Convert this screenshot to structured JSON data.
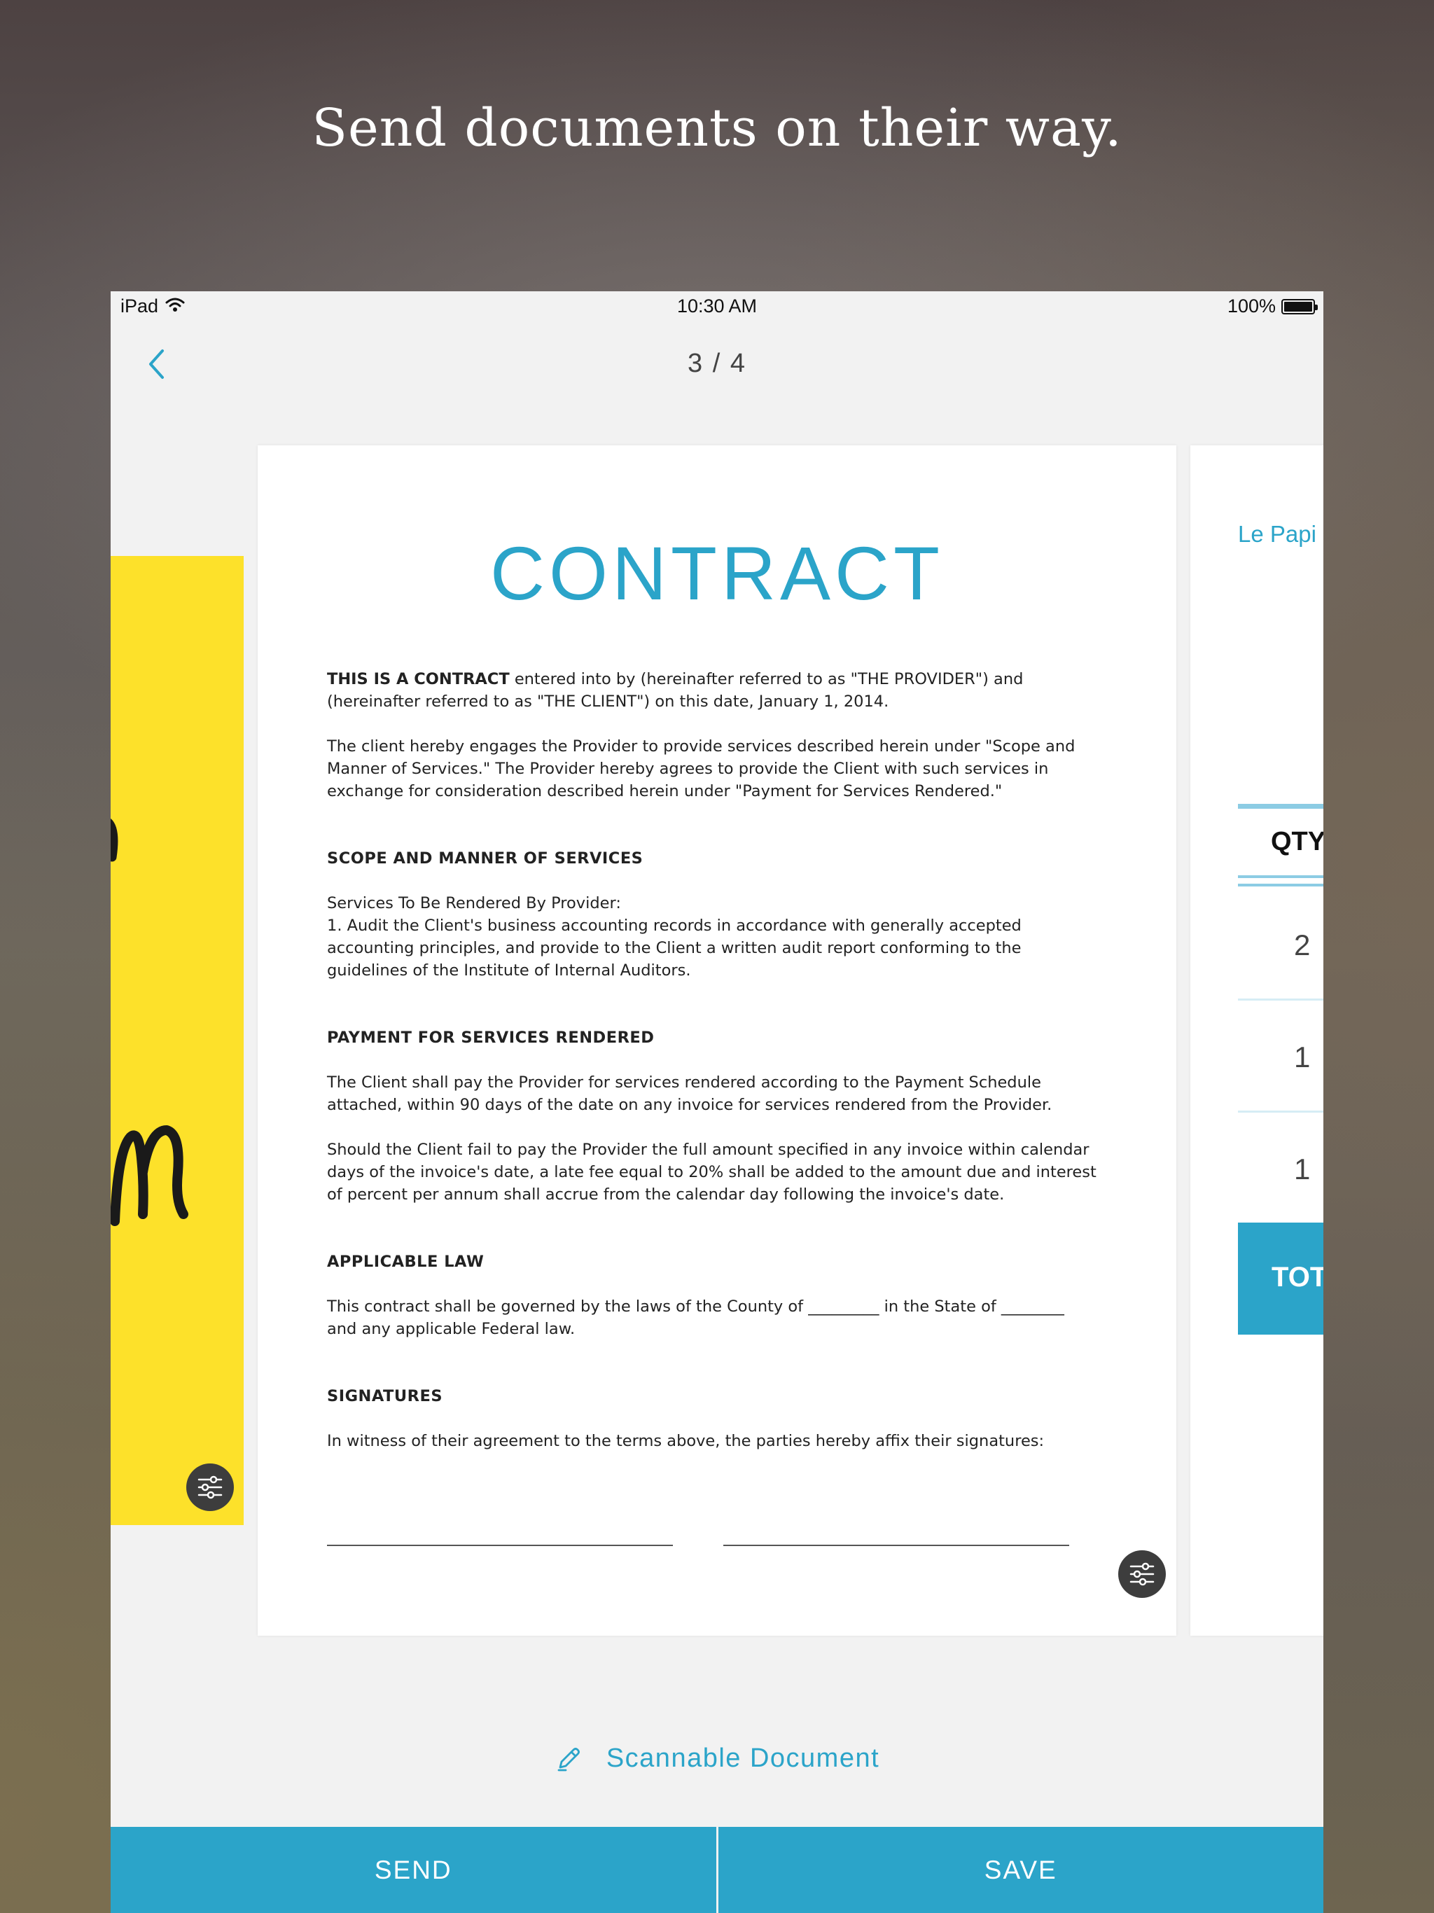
{
  "headline": "Send documents on their way.",
  "status_bar": {
    "device": "iPad",
    "time": "10:30 AM",
    "battery": "100%"
  },
  "nav": {
    "page_counter": "3 / 4"
  },
  "document": {
    "title": "CONTRACT",
    "intro_bold": "THIS IS A CONTRACT",
    "intro_rest": " entered into by (hereinafter referred to as \"THE PROVIDER\") and\n(hereinafter referred to as \"THE CLIENT\") on this date, January 1, 2014.",
    "para_engage": "The client hereby engages the Provider to provide services described herein under \"Scope and\nManner of Services.\" The Provider hereby agrees to provide the Client with such services in\nexchange for consideration described herein under \"Payment for Services Rendered.\"",
    "scope_heading": "SCOPE AND MANNER OF SERVICES",
    "scope_text": "Services To Be Rendered By Provider:\n1. Audit the Client's business accounting records in accordance with generally accepted\naccounting principles, and provide to the Client a written audit report conforming to the\nguidelines of the Institute of Internal Auditors.",
    "payment_heading": "PAYMENT FOR SERVICES RENDERED",
    "payment_text_1": "The Client shall pay the Provider for services rendered according to the Payment Schedule\nattached, within 90 days of the date on any invoice for services rendered from the Provider.",
    "payment_text_2": "Should the Client fail to pay the Provider the full amount specified in any invoice within calendar\ndays of the invoice's date, a late fee equal to 20% shall be added to the amount due and interest\nof percent per annum shall accrue from the calendar day following the invoice's date.",
    "law_heading": "APPLICABLE LAW",
    "law_text": "This contract shall be governed by the laws of the County of _________ in the State of ________\nand any applicable Federal law.",
    "sig_heading": "SIGNATURES",
    "sig_text": "In witness of their agreement to the terms above, the parties hereby affix their signatures:"
  },
  "right_page": {
    "brand": "Le Papi",
    "qty_header": "QTY",
    "qty_values": [
      "2",
      "1",
      "1"
    ],
    "total_label": "TOT"
  },
  "scannable_label": "Scannable Document",
  "actions": {
    "send": "SEND",
    "save": "SAVE"
  },
  "colors": {
    "accent": "#2ba4c9",
    "yellow_page": "#fde12a",
    "screen_bg": "#f2f2f2"
  },
  "icons": [
    "wifi-icon",
    "battery-icon",
    "back-chevron-icon",
    "adjust-sliders-icon",
    "pencil-icon"
  ]
}
